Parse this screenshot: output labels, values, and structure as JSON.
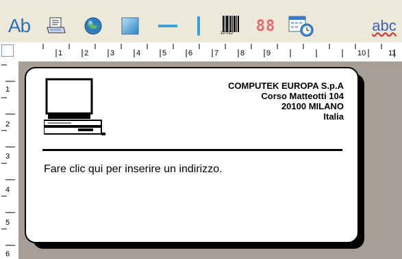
{
  "toolbar": {
    "text_tool_label": "Ab",
    "barcode_caption": "10 012",
    "counter_label": "88",
    "spellcheck_label": "abc",
    "tools": [
      "text-icon",
      "address-book-icon",
      "image-globe-icon",
      "rectangle-icon",
      "horizontal-line-icon",
      "vertical-line-icon",
      "barcode-icon",
      "counter-icon",
      "date-calendar-icon",
      "spellcheck-icon"
    ]
  },
  "ruler": {
    "horizontal_numbers": [
      "1",
      "2",
      "3",
      "4",
      "5",
      "6",
      "7",
      "8",
      "9",
      "10",
      "11"
    ],
    "vertical_numbers": [
      "1",
      "2",
      "3",
      "4",
      "5",
      "6"
    ]
  },
  "label": {
    "company_lines": [
      "COMPUTEK EUROPA S.p.A",
      "Corso Matteotti 104",
      "20100 MILANO",
      "Italia"
    ],
    "address_placeholder": "Fare clic qui per inserire un indirizzo."
  },
  "colors": {
    "canvas_bg": "#a59f95",
    "toolbar_bg": "#ece9d8",
    "accent": "#2a73b8"
  }
}
